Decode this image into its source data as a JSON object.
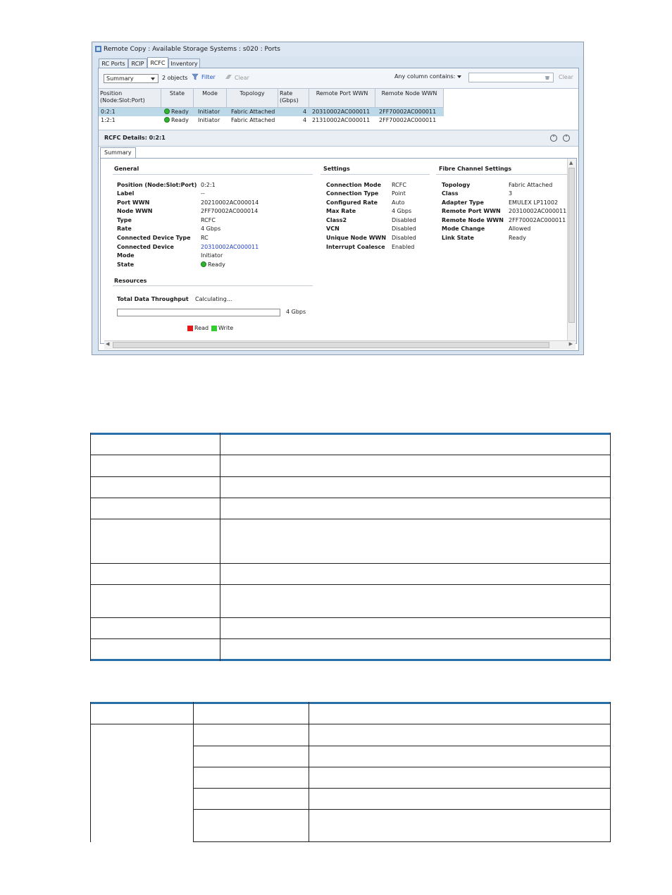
{
  "window": {
    "title": "Remote Copy : Available Storage Systems : s020 : Ports"
  },
  "tabs": [
    {
      "label": "RC Ports"
    },
    {
      "label": "RCIP"
    },
    {
      "label": "RCFC"
    },
    {
      "label": "Inventory"
    }
  ],
  "toolbar": {
    "view_select": "Summary",
    "object_count": "2 objects",
    "filter_label": "Filter",
    "clear_label": "Clear",
    "any_column_label": "Any column contains:",
    "search_value": "",
    "search_clear_label": "Clear"
  },
  "grid": {
    "columns": [
      "Position (Node:Slot:Port)",
      "State",
      "Mode",
      "Topology",
      "Rate (Gbps)",
      "Remote Port WWN",
      "Remote Node WWN"
    ],
    "rows": [
      {
        "position": "0:2:1",
        "state": "Ready",
        "mode": "Initiator",
        "topology": "Fabric Attached",
        "rate": "4",
        "remote_port_wwn": "20310002AC000011",
        "remote_node_wwn": "2FF70002AC000011"
      },
      {
        "position": "1:2:1",
        "state": "Ready",
        "mode": "Initiator",
        "topology": "Fabric Attached",
        "rate": "4",
        "remote_port_wwn": "21310002AC000011",
        "remote_node_wwn": "2FF70002AC000011"
      }
    ]
  },
  "details": {
    "header": "RCFC Details: 0:2:1",
    "subtab": "Summary",
    "general": {
      "title": "General",
      "items": [
        {
          "k": "Position (Node:Slot:Port)",
          "v": "0:2:1"
        },
        {
          "k": "Label",
          "v": "--"
        },
        {
          "k": "Port WWN",
          "v": "20210002AC000014"
        },
        {
          "k": "Node WWN",
          "v": "2FF70002AC000014"
        },
        {
          "k": "Type",
          "v": "RCFC"
        },
        {
          "k": "Rate",
          "v": "4 Gbps"
        },
        {
          "k": "Connected Device Type",
          "v": "RC"
        },
        {
          "k": "Connected Device",
          "v": "20310002AC000011"
        },
        {
          "k": "Mode",
          "v": "Initiator"
        },
        {
          "k": "State",
          "v": "Ready"
        }
      ]
    },
    "settings": {
      "title": "Settings",
      "items": [
        {
          "k": "Connection Mode",
          "v": "RCFC"
        },
        {
          "k": "Connection Type",
          "v": "Point"
        },
        {
          "k": "Configured Rate",
          "v": "Auto"
        },
        {
          "k": "Max Rate",
          "v": "4 Gbps"
        },
        {
          "k": "Class2",
          "v": "Disabled"
        },
        {
          "k": "VCN",
          "v": "Disabled"
        },
        {
          "k": "Unique Node WWN",
          "v": "Disabled"
        },
        {
          "k": "Interrupt Coalesce",
          "v": "Enabled"
        }
      ]
    },
    "fc": {
      "title": "Fibre Channel Settings",
      "items": [
        {
          "k": "Topology",
          "v": "Fabric Attached"
        },
        {
          "k": "Class",
          "v": "3"
        },
        {
          "k": "Adapter Type",
          "v": "EMULEX LP11002"
        },
        {
          "k": "Remote Port WWN",
          "v": "20310002AC000011"
        },
        {
          "k": "Remote Node WWN",
          "v": "2FF70002AC000011"
        },
        {
          "k": "Mode Change",
          "v": "Allowed"
        },
        {
          "k": "Link State",
          "v": "Ready"
        }
      ]
    },
    "resources": {
      "title": "Resources",
      "throughput_label": "Total Data Throughput",
      "throughput_value": "Calculating...",
      "bar_max_label": "4 Gbps",
      "legend_read": "Read",
      "legend_write": "Write"
    }
  },
  "colors": {
    "read": "#e01919",
    "write": "#33cc33",
    "selection": "#bcd9e9",
    "rule": "#2a6fa8"
  }
}
